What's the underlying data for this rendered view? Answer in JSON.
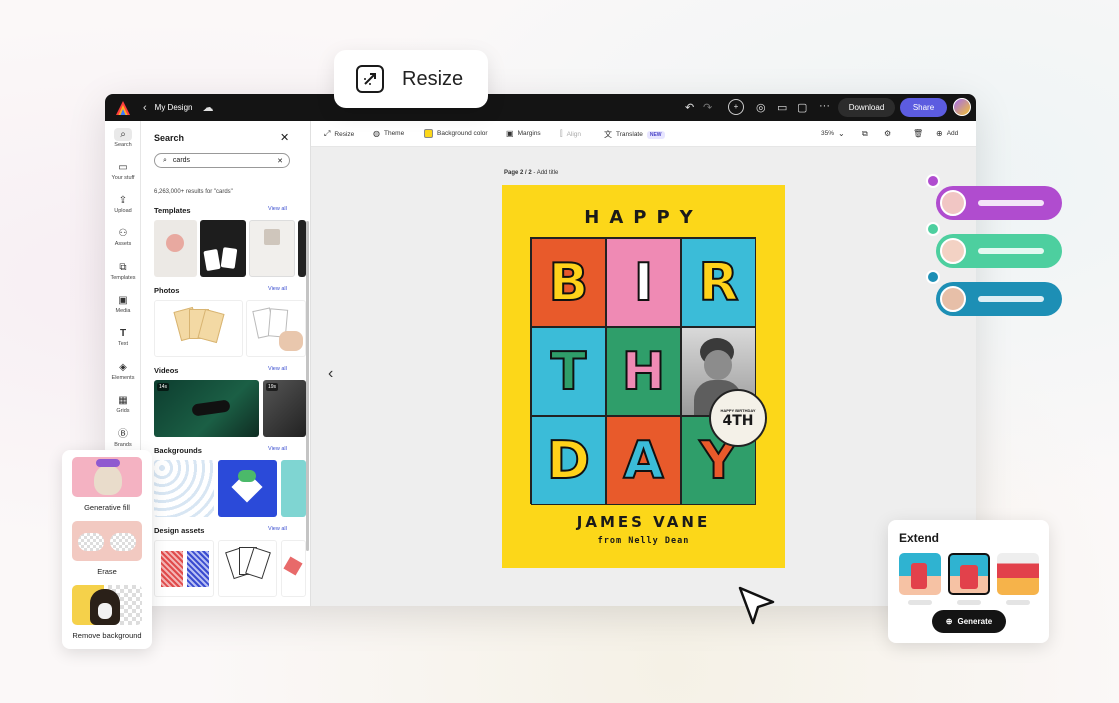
{
  "feature_chip": {
    "label": "Resize",
    "icon": "resize-icon"
  },
  "topbar": {
    "doc_title": "My Design",
    "download_label": "Download",
    "share_label": "Share",
    "colors": {
      "bg": "#141414",
      "share": "#5c5ce0"
    }
  },
  "rail": {
    "items": [
      {
        "label": "Search",
        "icon": "search-icon"
      },
      {
        "label": "Your stuff",
        "icon": "folder-icon"
      },
      {
        "label": "Upload",
        "icon": "upload-icon"
      },
      {
        "label": "Assets",
        "icon": "assets-icon"
      },
      {
        "label": "Templates",
        "icon": "templates-icon"
      },
      {
        "label": "Media",
        "icon": "media-icon"
      },
      {
        "label": "Text",
        "icon": "text-icon"
      },
      {
        "label": "Elements",
        "icon": "elements-icon"
      },
      {
        "label": "Grids",
        "icon": "grids-icon"
      },
      {
        "label": "Brands",
        "icon": "brands-icon"
      }
    ]
  },
  "panel": {
    "title": "Search",
    "search_value": "cards",
    "result_count": "6,263,000+ results for \"cards\"",
    "view_all": "View all",
    "sections": {
      "templates": "Templates",
      "photos": "Photos",
      "videos": "Videos",
      "backgrounds": "Backgrounds",
      "design_assets": "Design assets"
    },
    "video_durations": [
      "14s",
      "19s"
    ]
  },
  "toolbar": {
    "resize": "Resize",
    "theme": "Theme",
    "background_color": "Background color",
    "margins": "Margins",
    "align": "Align",
    "translate": "Translate",
    "new_badge": "NEW",
    "zoom": "35%",
    "add": "Add"
  },
  "canvas": {
    "page_label": "Page 2 / 2",
    "add_title": "- Add title"
  },
  "poster": {
    "happy": "HAPPY",
    "letters": [
      "B",
      "I",
      "R",
      "T",
      "H",
      "",
      "D",
      "A",
      "Y"
    ],
    "name": "JAMES VANE",
    "from": "from Nelly Dean",
    "badge_number": "4TH",
    "badge_text": "HAPPY BIRTHDAY"
  },
  "ai_panel": {
    "items": [
      "Generative fill",
      "Erase",
      "Remove background"
    ]
  },
  "extend_panel": {
    "title": "Extend",
    "generate_label": "Generate"
  },
  "collaborators": [
    {
      "color": "#b04ccf"
    },
    {
      "color": "#4dcf9f"
    },
    {
      "color": "#1d8fb5"
    }
  ]
}
